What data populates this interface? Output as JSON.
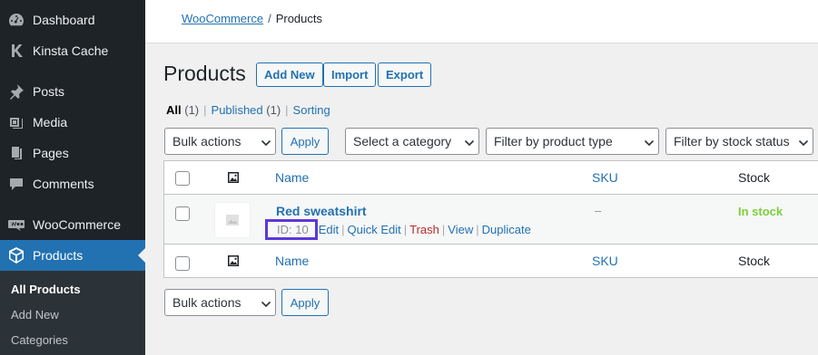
{
  "sidebar": {
    "items": [
      {
        "label": "Dashboard",
        "icon": "dashboard-icon"
      },
      {
        "label": "Kinsta Cache",
        "icon": "kinsta-icon"
      },
      {
        "label": "Posts",
        "icon": "pushpin-icon"
      },
      {
        "label": "Media",
        "icon": "media-icon"
      },
      {
        "label": "Pages",
        "icon": "pages-icon"
      },
      {
        "label": "Comments",
        "icon": "comment-icon"
      },
      {
        "label": "WooCommerce",
        "icon": "woocommerce-icon"
      },
      {
        "label": "Products",
        "icon": "box-icon"
      }
    ],
    "submenu": [
      "All Products",
      "Add New",
      "Categories"
    ]
  },
  "breadcrumb": {
    "parent": "WooCommerce",
    "separator": "/",
    "current": "Products"
  },
  "page": {
    "title": "Products",
    "buttons": [
      "Add New",
      "Import",
      "Export"
    ]
  },
  "views": {
    "all_label": "All",
    "all_count": "(1)",
    "published_label": "Published",
    "published_count": "(1)",
    "sorting_label": "Sorting",
    "pipe": "|"
  },
  "filters": {
    "bulk_actions": "Bulk actions",
    "apply": "Apply",
    "category": "Select a category",
    "product_type": "Filter by product type",
    "stock_status": "Filter by stock status"
  },
  "table": {
    "columns": {
      "name": "Name",
      "sku": "SKU",
      "stock": "Stock"
    },
    "rows": [
      {
        "name": "Red sweatshirt",
        "id_label": "ID: 10",
        "actions": {
          "edit": "Edit",
          "quick_edit": "Quick Edit",
          "trash": "Trash",
          "view": "View",
          "duplicate": "Duplicate"
        },
        "sku": "–",
        "stock": "In stock"
      }
    ]
  },
  "colors": {
    "sidebar_bg": "#1d2327",
    "accent": "#2271b1",
    "highlight_box": "#5b38d8",
    "in_stock": "#7ad03a",
    "trash": "#b32d2e"
  }
}
